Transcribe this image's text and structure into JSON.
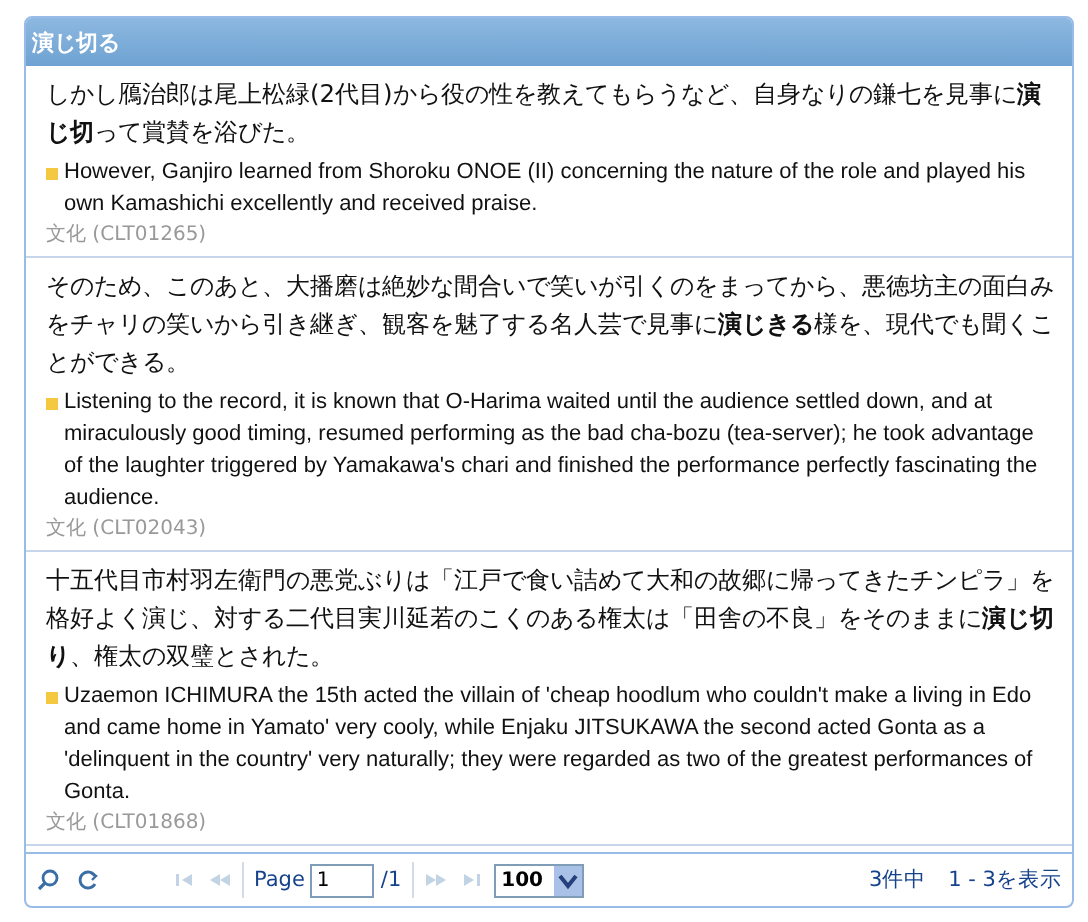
{
  "panel": {
    "title": "演じ切る"
  },
  "entries": [
    {
      "japanese": "しかし鴈治郎は尾上松緑(2代目)から役の性を教えてもらうなど、自身なりの鎌七を見事に**演じ切**って賞賛を浴びた。",
      "english": "However, Ganjiro learned from Shoroku ONOE (II) concerning the nature of the role and played his own Kamashichi excellently and received praise.",
      "source": "文化 (CLT01265)"
    },
    {
      "japanese": "そのため、このあと、大播磨は絶妙な間合いで笑いが引くのをまってから、悪徳坊主の面白みをチャリの笑いから引き継ぎ、観客を魅了する名人芸で見事に**演じきる**様を、現代でも聞くことができる。",
      "english": "Listening to the record, it is known that O-Harima waited until the audience settled down, and at miraculously good timing, resumed performing as the bad cha-bozu (tea-server); he took advantage of the laughter triggered by Yamakawa's chari and finished the performance perfectly fascinating the audience.",
      "source": "文化 (CLT02043)"
    },
    {
      "japanese": "十五代目市村羽左衛門の悪党ぶりは「江戸で食い詰めて大和の故郷に帰ってきたチンピラ」を格好よく演じ、対する二代目実川延若のこくのある権太は「田舎の不良」をそのままに**演じ切り**、権太の双璧とされた。",
      "english": "Uzaemon ICHIMURA the 15th acted the villain of 'cheap hoodlum who couldn't make a living in Edo and came home in Yamato' very cooly, while Enjaku JITSUKAWA the second acted Gonta as a 'delinquent in the country' very naturally; they were regarded as two of the greatest performances of Gonta.",
      "source": "文化 (CLT01868)"
    }
  ],
  "pager": {
    "nav": [
      {
        "kind": "first",
        "disabled": true
      },
      {
        "kind": "prev",
        "disabled": true
      },
      {
        "kind": "next",
        "disabled": true
      },
      {
        "kind": "last",
        "disabled": true
      }
    ],
    "page_label": "Page",
    "page": "1",
    "total": "/1",
    "page_size": "100",
    "summary": "3件中　1 - 3を表示"
  }
}
